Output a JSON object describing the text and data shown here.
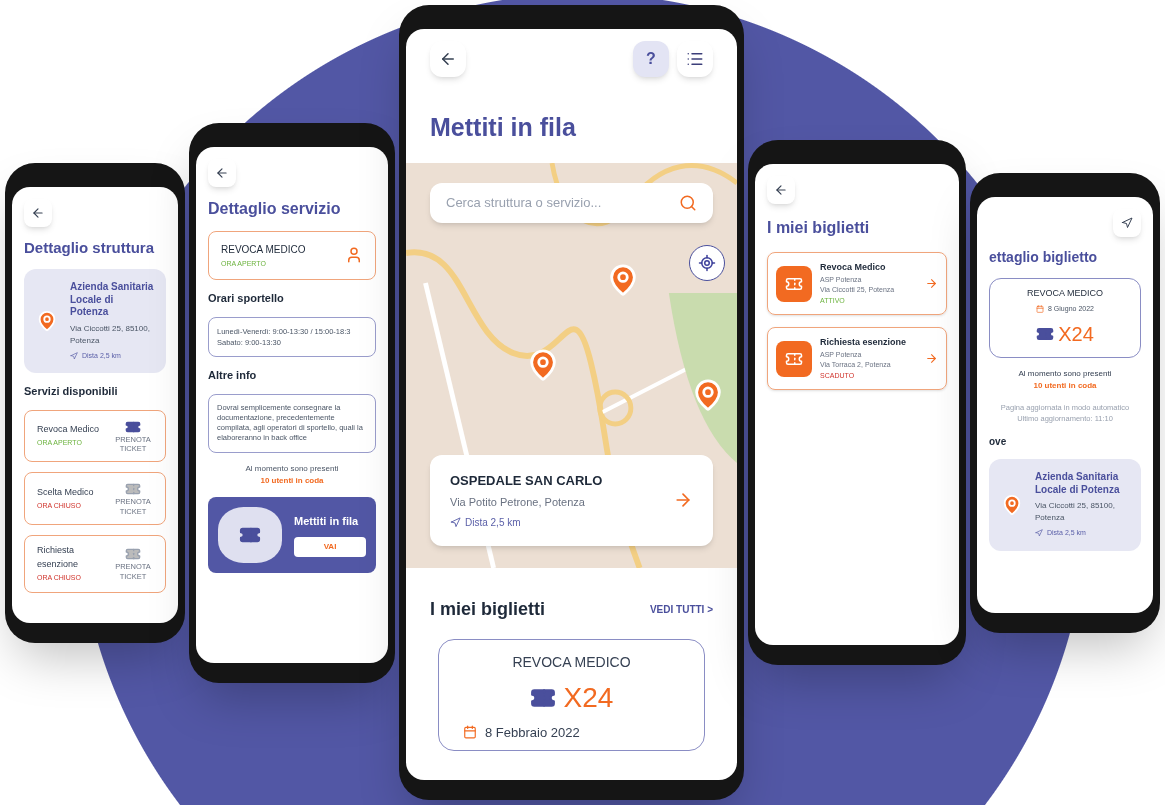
{
  "structure_screen": {
    "title": "Dettaglio struttura",
    "place": {
      "name": "Azienda Sanitaria Locale di Potenza",
      "address": "Via Ciccotti 25, 85100, Potenza",
      "distance": "Dista 2,5 km"
    },
    "section": "Servizi disponibili",
    "services": [
      {
        "name": "Revoca Medico",
        "status": "ORA APERTO",
        "open": true,
        "action": "PRENOTA TICKET"
      },
      {
        "name": "Scelta Medico",
        "status": "ORA CHIUSO",
        "open": false,
        "action": "PRENOTA TICKET"
      },
      {
        "name": "Richiesta esenzione",
        "status": "ORA CHIUSO",
        "open": false,
        "action": "PRENOTA TICKET"
      }
    ]
  },
  "service_screen": {
    "title": "Dettaglio servizio",
    "service": {
      "name": "REVOCA MEDICO",
      "status": "ORA APERTO",
      "open": true
    },
    "hours_title": "Orari sportello",
    "hours": [
      "Lunedì-Venerdì: 9:00-13:30 / 15:00-18:3",
      "Sabato: 9:00-13:30"
    ],
    "info_title": "Altre info",
    "info": "Dovrai semplicemente consegnare la documentazione, precedentemente compilata, agli operatori di sportello, quali la elaboreranno in back office",
    "queue_text": "Al momento sono presenti",
    "queue_count": "10 utenti in coda",
    "banner": {
      "title": "Mettiti in fila",
      "button": "VAI"
    }
  },
  "queue_screen": {
    "help_button": {
      "label": "?",
      "highlighted": true
    },
    "title": "Mettiti in fila",
    "search": {
      "placeholder": "Cerca struttura o servizio..."
    },
    "place": {
      "name": "OSPEDALE SAN CARLO",
      "address": "Via Potito Petrone, Potenza",
      "distance": "Dista 2,5 km"
    },
    "tickets_title": "I miei biglietti",
    "see_all": "VEDI TUTTI >",
    "ticket": {
      "service": "REVOCA MEDICO",
      "number": "X24",
      "date": "8 Febbraio 2022"
    }
  },
  "tickets_screen": {
    "title": "I miei biglietti",
    "tickets": [
      {
        "name": "Revoca Medico",
        "org": "ASP Potenza",
        "address": "Via Ciccotti 25, Potenza",
        "status": "ATTIVO",
        "active": true
      },
      {
        "name": "Richiesta esenzione",
        "org": "ASP Potenza",
        "address": "Via Torraca 2, Potenza",
        "status": "SCADUTO",
        "active": false
      }
    ]
  },
  "ticket_detail_screen": {
    "title": "ettaglio biglietto",
    "ticket": {
      "service": "REVOCA MEDICO",
      "date": "8 Giugno 2022",
      "number": "X24"
    },
    "queue_text": "Al momento sono presenti",
    "queue_count": "10 utenti in coda",
    "update_note": [
      "Pagina aggiornata in modo automatico",
      "Ultimo aggiornamento: 11:10"
    ],
    "where_title": "ove",
    "place": {
      "name": "Azienda Sanitaria Locale di Potenza",
      "address": "Via Ciccotti 25, 85100, Potenza",
      "distance": "Dista 2,5 km"
    }
  }
}
